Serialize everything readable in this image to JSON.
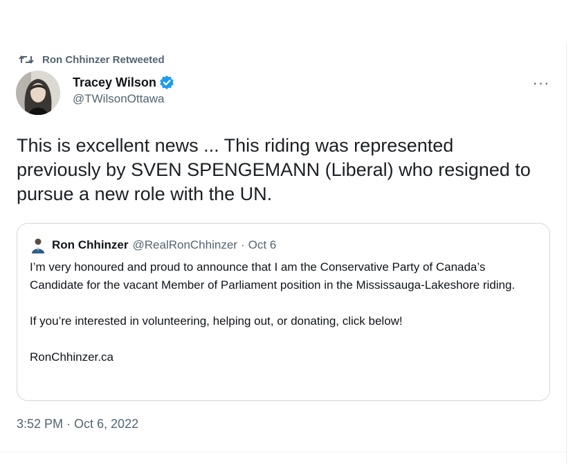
{
  "retweet": {
    "icon": "retweet-icon",
    "label": "Ron Chhinzer Retweeted"
  },
  "author": {
    "display_name": "Tracey Wilson",
    "verified": true,
    "handle": "@TWilsonOttawa",
    "avatar_icon": "profile-photo"
  },
  "more_label": "···",
  "tweet": {
    "text": "This is excellent news ... This riding was represented previously by SVEN SPENGEMANN (Liberal) who resigned to pursue a new role with the UN.",
    "timestamp": "3:52 PM · Oct 6, 2022"
  },
  "quote": {
    "name": "Ron Chhinzer",
    "handle": "@RealRonChhinzer",
    "separator": "·",
    "date": "Oct 6",
    "paragraphs": [
      "I’m very honoured and proud to announce that I am the Conservative Party of Canada’s Candidate for the vacant Member of Parliament position in the Mississauga-Lakeshore riding.",
      "If you’re interested in volunteering, helping out, or donating, click below!",
      "RonChhinzer.ca"
    ]
  },
  "colors": {
    "text": "#0f1419",
    "secondary": "#536471",
    "verified": "#1d9bf0",
    "border": "#cfd9de"
  }
}
